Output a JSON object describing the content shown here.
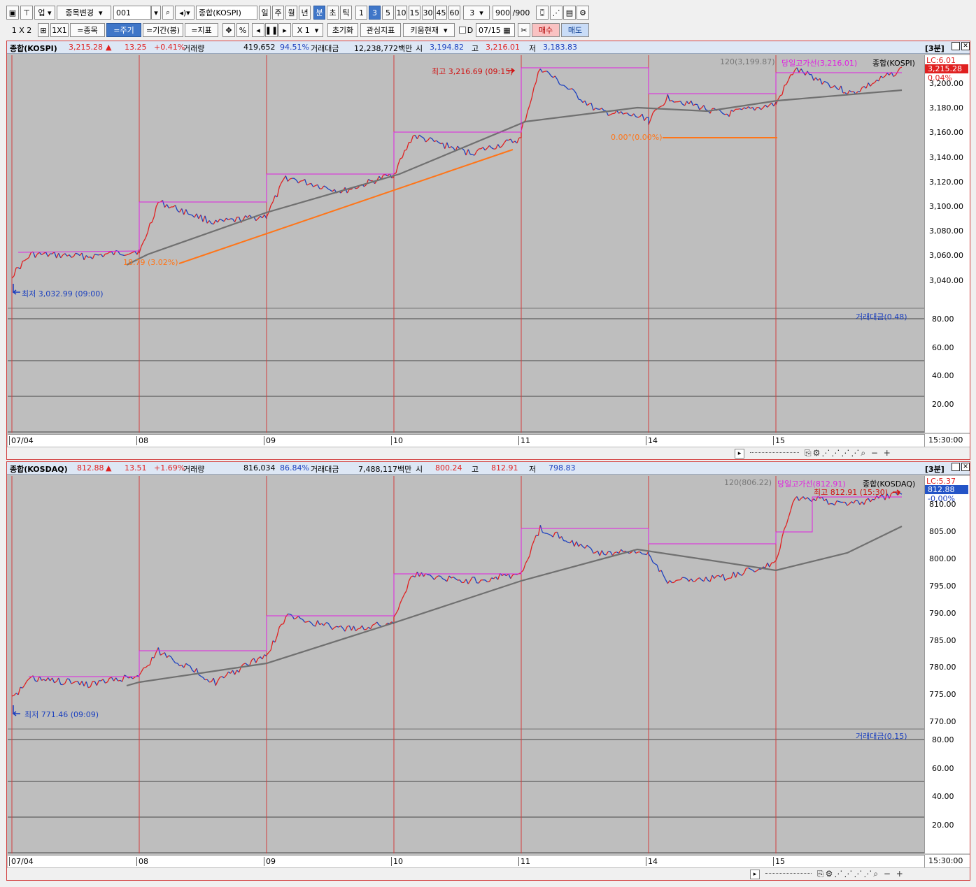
{
  "toolbar1": {
    "market": "업",
    "change_symbol": "종목변경",
    "code": "001",
    "index_name": "종합(KOSPI)",
    "periods": [
      "일",
      "주",
      "월",
      "년",
      "분",
      "초",
      "틱"
    ],
    "minutes": [
      "1",
      "3",
      "5",
      "10",
      "15",
      "30",
      "45",
      "60"
    ],
    "minute_select": "3",
    "count": "900",
    "count_total": "/900"
  },
  "toolbar2": {
    "layout_1x2": "1 X 2",
    "layout_1x1": "1X1",
    "symbol_btn": "=종목",
    "period_btn": "=주기",
    "range_btn": "=기간(봉)",
    "indicator_btn": "=지표",
    "percent": "%",
    "zoom": "X 1",
    "reset": "초기화",
    "watch_ind": "관심지표",
    "kiwoom": "키움현재",
    "d_label": "D",
    "date": "07/15",
    "buy": "매수",
    "sell": "매도"
  },
  "panel1": {
    "name": "종합(KOSPI)",
    "price": "3,215.28",
    "arrow": "▲",
    "change": "13.25",
    "change_pct": "+0.41%",
    "volume_label": "거래량",
    "volume": "419,652",
    "volume_pct": "94.51%",
    "amount_label": "거래대금",
    "amount": "12,238,772백만",
    "open_label": "시",
    "open": "3,194.82",
    "high_label": "고",
    "high": "3,216.01",
    "low_label": "저",
    "low": "3,183.83",
    "interval": "[3분]",
    "ma_legend": "120(3,199.87)",
    "high_line_legend": "당일고가선(3,216.01)",
    "series_legend": "종합(KOSPI)",
    "lc": "LC:6.01",
    "last_price": "3,215.28",
    "last_pct": "0.04%",
    "max_label": "최고 3,216.69 (09:15)",
    "min_label": "최저 3,032.99 (09:00)",
    "trend_label": "18.79 (3.02%)",
    "flat_label": "0.00°(0.00%)",
    "sub_legend": "거래대금(0.48)",
    "yticks": [
      "3,200.00",
      "3,180.00",
      "3,160.00",
      "3,140.00",
      "3,120.00",
      "3,100.00",
      "3,080.00",
      "3,060.00",
      "3,040.00"
    ],
    "sub_ticks": [
      "80.00",
      "60.00",
      "40.00",
      "20.00"
    ],
    "dates": [
      "07/04",
      "08",
      "09",
      "10",
      "11",
      "14",
      "15"
    ],
    "time": "15:30:00"
  },
  "panel2": {
    "name": "종합(KOSDAQ)",
    "price": "812.88",
    "arrow": "▲",
    "change": "13.51",
    "change_pct": "+1.69%",
    "volume_label": "거래량",
    "volume": "816,034",
    "volume_pct": "86.84%",
    "amount_label": "거래대금",
    "amount": "7,488,117백만",
    "open_label": "시",
    "open": "800.24",
    "high_label": "고",
    "high": "812.91",
    "low_label": "저",
    "low": "798.83",
    "interval": "[3분]",
    "ma_legend": "120(806.22)",
    "high_line_legend": "당일고가선(812.91)",
    "series_legend": "종합(KOSDAQ)",
    "lc": "LC:5.37",
    "last_price": "812.88",
    "last_pct": "-0.00%",
    "max_label": "최고 812.91 (15:30)",
    "min_label": "최저 771.46 (09:09)",
    "sub_legend": "거래대금(0.15)",
    "yticks": [
      "810.00",
      "805.00",
      "800.00",
      "795.00",
      "790.00",
      "785.00",
      "780.00",
      "775.00",
      "770.00"
    ],
    "sub_ticks": [
      "80.00",
      "60.00",
      "40.00",
      "20.00"
    ],
    "dates": [
      "07/04",
      "08",
      "09",
      "10",
      "11",
      "14",
      "15"
    ],
    "time": "15:30:00"
  },
  "colors": {
    "up": "#e02020",
    "down": "#1a3fbf",
    "ma": "#707070",
    "highline": "#e020e0",
    "trend": "#ff7518",
    "session": "#d23d3d"
  }
}
